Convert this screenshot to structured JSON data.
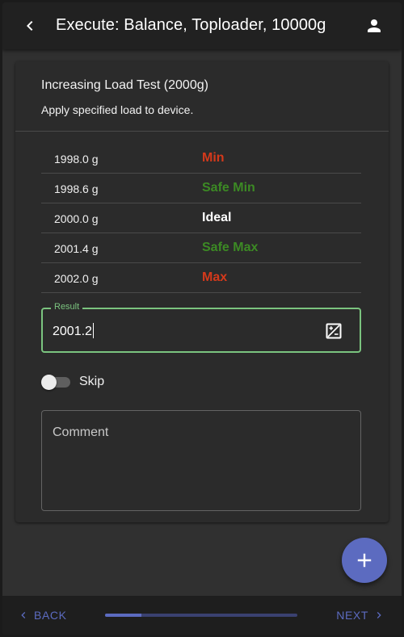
{
  "header": {
    "title": "Execute: Balance, Toploader, 10000g",
    "back_icon": "chevron-left-icon",
    "account_icon": "person-icon"
  },
  "card": {
    "title": "Increasing Load Test (2000g)",
    "subtitle": "Apply specified load to device."
  },
  "spec_rows": [
    {
      "value": "1998.0 g",
      "label": "Min",
      "color": "#d4391b"
    },
    {
      "value": "1998.6 g",
      "label": "Safe Min",
      "color": "#3c8a24"
    },
    {
      "value": "2000.0 g",
      "label": "Ideal",
      "color": "#ffffff"
    },
    {
      "value": "2001.4 g",
      "label": "Safe Max",
      "color": "#3c8a24"
    },
    {
      "value": "2002.0 g",
      "label": "Max",
      "color": "#d4391b"
    }
  ],
  "result": {
    "label": "Result",
    "value": "2001.2",
    "icon": "calculator-icon"
  },
  "skip": {
    "label": "Skip",
    "checked": false
  },
  "comment": {
    "placeholder": "Comment",
    "value": ""
  },
  "fab": {
    "icon": "plus-icon"
  },
  "footer": {
    "back_label": "BACK",
    "next_label": "NEXT",
    "progress": 0.19
  },
  "colors": {
    "accent": "#5c6bc0",
    "success": "#7bc47f",
    "error": "#d4391b",
    "safe": "#3c8a24"
  }
}
